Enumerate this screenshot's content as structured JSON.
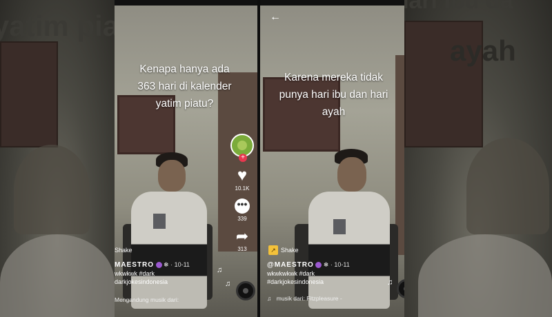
{
  "background": {
    "left_text": "yatim piat",
    "right_top_text": "punya hari ibu da",
    "right_text": "ayah"
  },
  "panel1": {
    "caption": [
      "Kenapa hanya ada",
      "363 hari di kalender",
      "yatim piatu?"
    ],
    "likes": "10.1K",
    "comments": "339",
    "shares": "313",
    "shake_label": "Shake",
    "username": "MAESTRO",
    "date": "· 10-11",
    "desc_line1": "wkwkwk #dark",
    "desc_line2": "darkjokesindonesia",
    "music": "Mengandung musik dari:"
  },
  "panel2": {
    "back_glyph": "←",
    "caption": [
      "Karena mereka tidak",
      "punya hari ibu dan hari",
      "ayah"
    ],
    "shake_label": "Shake",
    "username": "@MAESTRO",
    "date": "· 10-11",
    "desc_line1": "wkwkwkwk #dark",
    "desc_line2": "#darkjokesindonesia",
    "music": "musik dari: Fitzpleasure -"
  },
  "icons": {
    "heart": "♥",
    "comment": "•••",
    "share": "➦",
    "note": "♫",
    "music": "♫",
    "plus": "+"
  },
  "colors": {
    "follow_badge": "#e8384f",
    "shake_badge": "#f3c13a"
  }
}
